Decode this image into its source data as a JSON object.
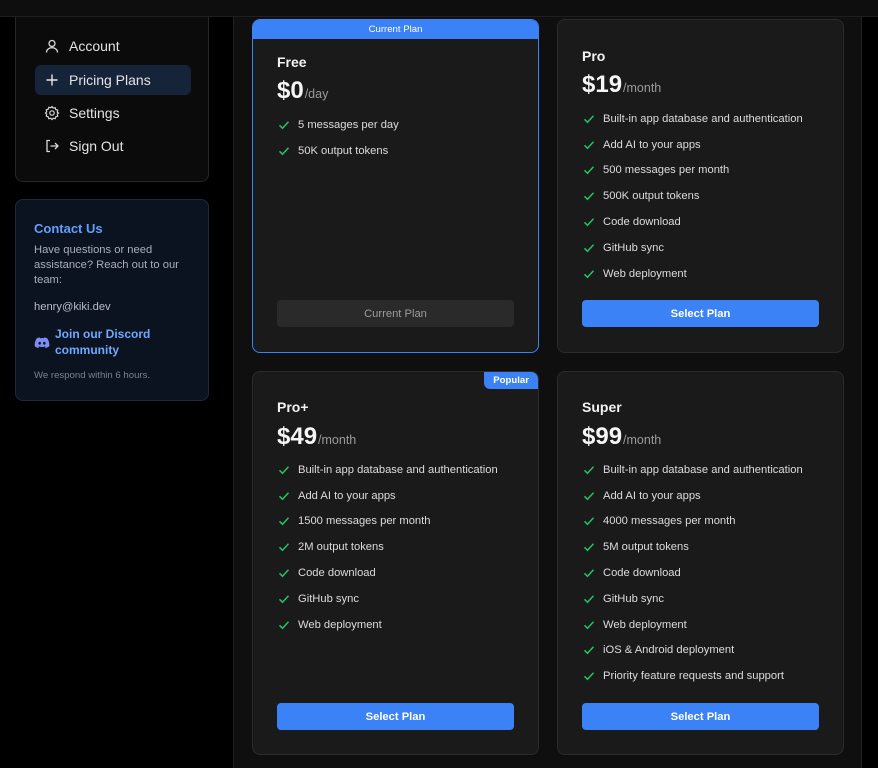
{
  "sidebar": {
    "items": [
      {
        "label": "Account",
        "icon": "user-icon"
      },
      {
        "label": "Pricing Plans",
        "icon": "plus-icon",
        "active": true
      },
      {
        "label": "Settings",
        "icon": "gear-icon"
      },
      {
        "label": "Sign Out",
        "icon": "sign-out-icon"
      }
    ]
  },
  "contact": {
    "title": "Contact Us",
    "description": "Have questions or need assistance? Reach out to our team:",
    "email": "henry@kiki.dev",
    "discord_label": "Join our Discord community",
    "note": "We respond within 6 hours."
  },
  "plans": [
    {
      "name": "Free",
      "price": "$0",
      "period": "/day",
      "banner": "Current Plan",
      "features": [
        "5 messages per day",
        "50K output tokens"
      ],
      "button": "Current Plan"
    },
    {
      "name": "Pro",
      "price": "$19",
      "period": "/month",
      "features": [
        "Built-in app database and authentication",
        "Add AI to your apps",
        "500 messages per month",
        "500K output tokens",
        "Code download",
        "GitHub sync",
        "Web deployment"
      ],
      "button": "Select Plan"
    },
    {
      "name": "Pro+",
      "price": "$49",
      "period": "/month",
      "badge": "Popular",
      "features": [
        "Built-in app database and authentication",
        "Add AI to your apps",
        "1500 messages per month",
        "2M output tokens",
        "Code download",
        "GitHub sync",
        "Web deployment"
      ],
      "button": "Select Plan"
    },
    {
      "name": "Super",
      "price": "$99",
      "period": "/month",
      "features": [
        "Built-in app database and authentication",
        "Add AI to your apps",
        "4000 messages per month",
        "5M output tokens",
        "Code download",
        "GitHub sync",
        "Web deployment",
        "iOS & Android deployment",
        "Priority feature requests and support"
      ],
      "button": "Select Plan"
    }
  ],
  "colors": {
    "accent": "#3b82f6",
    "check": "#22c55e",
    "card_bg": "#1a1a1a",
    "page_bg": "#000000"
  }
}
